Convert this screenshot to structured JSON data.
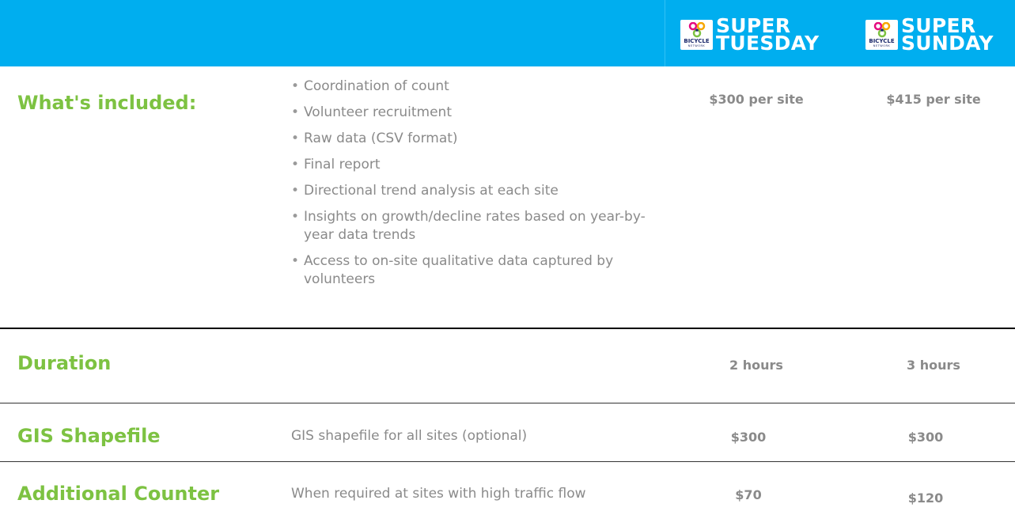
{
  "header": {
    "columns": [
      {
        "logo_word": "BICYCLE",
        "logo_sub": "NETWORK",
        "line1": "SUPER",
        "line2": "TUESDAY"
      },
      {
        "logo_word": "BICYCLE",
        "logo_sub": "NETWORK",
        "line1": "SUPER",
        "line2": "SUNDAY"
      }
    ]
  },
  "rows": {
    "included": {
      "title": "What's included:",
      "features": [
        "Coordination of count",
        "Volunteer recruitment",
        "Raw data (CSV format)",
        "Final report",
        "Directional trend analysis at each site",
        "Insights on growth/decline rates based on year-by-year data trends",
        "Access to on-site qualitative data captured by volunteers"
      ],
      "tuesday_price": "$300 per site",
      "sunday_price": "$415 per site"
    },
    "duration": {
      "title": "Duration",
      "tuesday": "2 hours",
      "sunday": "3 hours"
    },
    "gis": {
      "title": "GIS Shapefile",
      "description": "GIS shapefile for all sites (optional)",
      "tuesday": "$300",
      "sunday": "$300"
    },
    "counter": {
      "title": "Additional Counter",
      "description": "When required at sites with high traffic flow",
      "tuesday": "$70",
      "sunday": "$120"
    }
  },
  "colors": {
    "header_blue": "#00AEEF",
    "title_green": "#7DC242",
    "text_grey": "#8a8a8a"
  }
}
